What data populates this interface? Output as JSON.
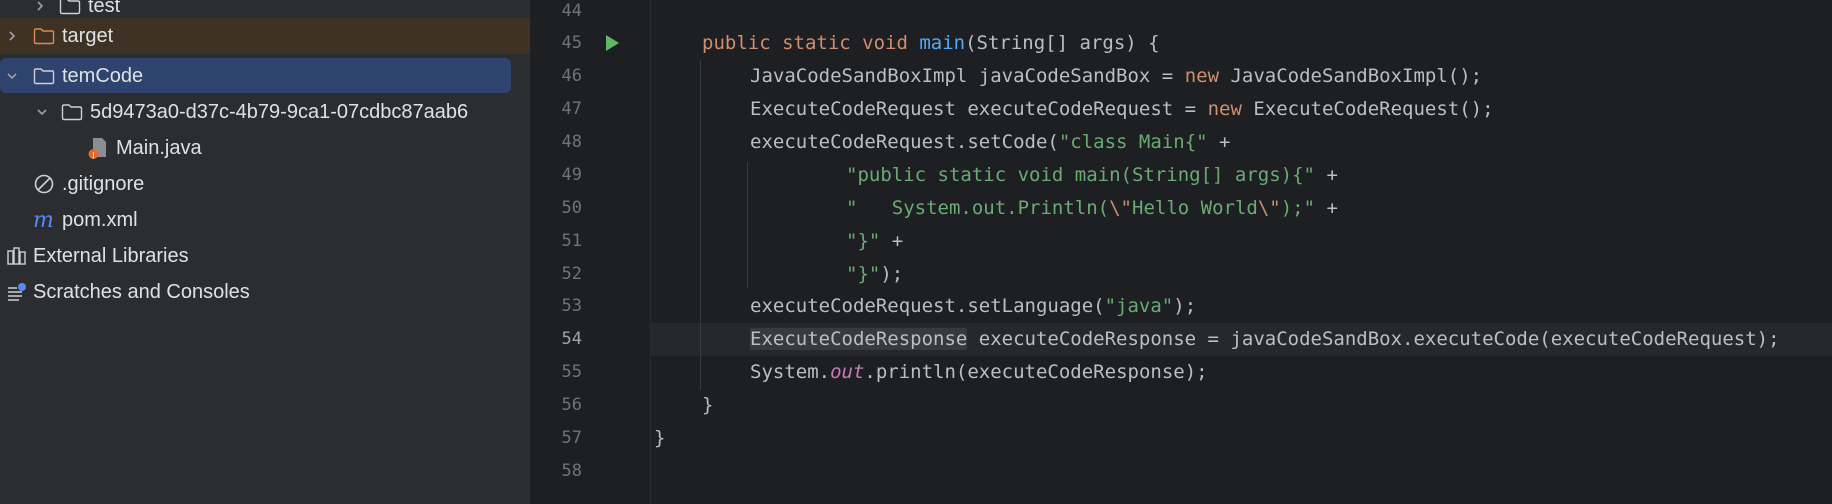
{
  "project_tree": {
    "items": [
      {
        "name": "test",
        "type": "folder",
        "expanded": false,
        "indent": 1
      },
      {
        "name": "target",
        "type": "folder-excluded",
        "expanded": false,
        "indent": 0
      },
      {
        "name": "temCode",
        "type": "folder",
        "expanded": true,
        "indent": 0,
        "selected": true
      },
      {
        "name": "5d9473a0-d37c-4b79-9ca1-07cdbc87aab6",
        "type": "folder",
        "expanded": true,
        "indent": 1
      },
      {
        "name": "Main.java",
        "type": "java-file",
        "indent": 2
      },
      {
        "name": ".gitignore",
        "type": "ignore-file",
        "indent": 0
      },
      {
        "name": "pom.xml",
        "type": "maven-file",
        "indent": 0
      },
      {
        "name": "External Libraries",
        "type": "libraries",
        "indent": -1
      },
      {
        "name": "Scratches and Consoles",
        "type": "scratches",
        "indent": -1
      }
    ]
  },
  "editor": {
    "line_numbers": [
      "44",
      "45",
      "46",
      "47",
      "48",
      "49",
      "50",
      "51",
      "52",
      "53",
      "54",
      "55",
      "56",
      "57",
      "58"
    ],
    "active_line": "54",
    "lines": {
      "l45": {
        "kw1": "public static void ",
        "fn": "main",
        "rest": "(String[] args) {"
      },
      "l46": {
        "a": "JavaCodeSandBoxImpl javaCodeSandBox = ",
        "kw": "new",
        "b": " JavaCodeSandBoxImpl();"
      },
      "l47": {
        "a": "ExecuteCodeRequest executeCodeRequest = ",
        "kw": "new",
        "b": " ExecuteCodeRequest();"
      },
      "l48": {
        "a": "executeCodeRequest.setCode(",
        "str": "\"class Main{\"",
        "b": " +"
      },
      "l49": {
        "str": "\"public static void main(String[] args){\"",
        "b": " +"
      },
      "l50": {
        "str1": "\"   System.out.Println(",
        "esc1": "\\\"",
        "str2": "Hello World",
        "esc2": "\\\"",
        "str3": ");\"",
        "b": " +"
      },
      "l51": {
        "str": "\"}\"",
        "b": " +"
      },
      "l52": {
        "str": "\"}\"",
        "b": ");"
      },
      "l53": {
        "a": "executeCodeRequest.setLanguage(",
        "str": "\"java\"",
        "b": ");"
      },
      "l54": {
        "hl": "ExecuteCodeResponse",
        "b": " executeCodeResponse = javaCodeSandBox.executeCode(executeCodeRequest);"
      },
      "l55": {
        "a": "System.",
        "stat": "out",
        "b": ".println(executeCodeResponse);"
      },
      "l56": {
        "a": "}"
      },
      "l57": {
        "a": "}"
      }
    }
  }
}
